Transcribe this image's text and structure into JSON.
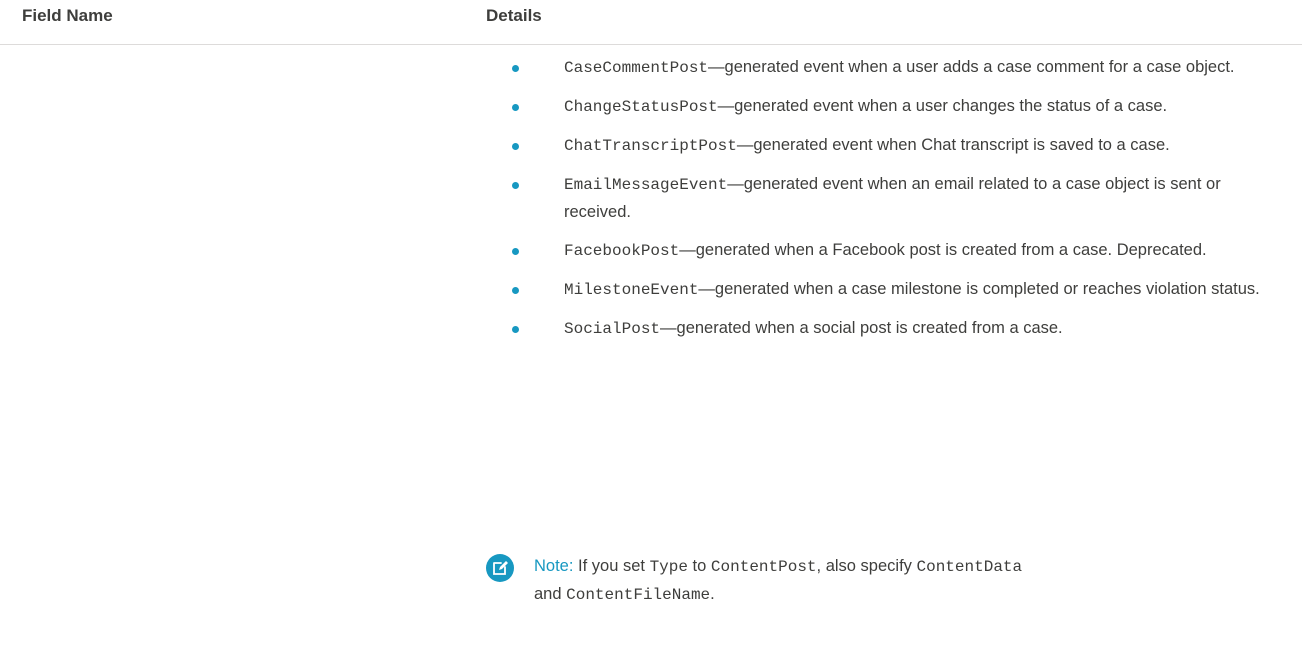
{
  "header": {
    "col1": "Field Name",
    "col2": "Details"
  },
  "items": [
    {
      "code": "CaseCommentPost",
      "desc": "—generated event when a user adds a case comment for a case object."
    },
    {
      "code": "ChangeStatusPost",
      "desc": "—generated event when a user changes the status of a case."
    },
    {
      "code": "ChatTranscriptPost",
      "desc": "—generated event when Chat transcript is saved to a case."
    },
    {
      "code": "EmailMessageEvent",
      "desc": "—generated event when an email related to a case object is sent or received."
    },
    {
      "code": "FacebookPost",
      "desc": "—generated when a Facebook post is created from a case. Deprecated."
    },
    {
      "code": "MilestoneEvent",
      "desc": "—generated when a case milestone is completed or reaches violation status."
    },
    {
      "code": "SocialPost",
      "desc": "—generated when a social post is created from a case."
    }
  ],
  "note": {
    "label": "Note:",
    "t1": " If you set ",
    "c1": "Type",
    "t2": " to ",
    "c2": "ContentPost",
    "t3": ", also specify ",
    "c3": "ContentData",
    "t4": " and ",
    "c4": "ContentFileName",
    "t5": "."
  },
  "icons": {
    "note": "edit-note-icon",
    "bullet": "bullet-dot-icon"
  },
  "colors": {
    "accent": "#1798c1",
    "text": "#3e3e3c",
    "divider": "#dddbda"
  }
}
